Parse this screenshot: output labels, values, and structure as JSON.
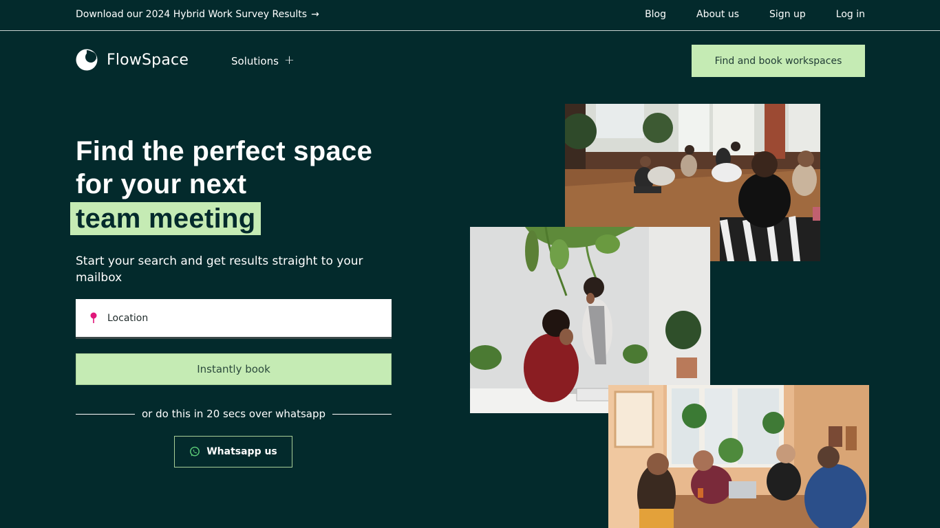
{
  "topbar": {
    "promo_text": "Download our 2024 Hybrid Work Survey Results",
    "promo_arrow": "→",
    "nav": [
      {
        "label": "Blog"
      },
      {
        "label": "About us"
      },
      {
        "label": "Sign up"
      },
      {
        "label": "Log in"
      }
    ]
  },
  "header": {
    "brand": "FlowSpace",
    "solutions_label": "Solutions",
    "solutions_icon": "+",
    "cta_label": "Find and book workspaces"
  },
  "hero": {
    "headline_line1": "Find the perfect space",
    "headline_line2": "for your next",
    "headline_highlight": "team meeting",
    "subtext": "Start your search and get results straight to your mailbox",
    "location_placeholder": "Location",
    "book_label": "Instantly book",
    "divider_text": "or do this in 20 secs over whatsapp",
    "whatsapp_label": "Whatsapp us"
  },
  "colors": {
    "background": "#032a2c",
    "accent": "#c5ebb4",
    "pin": "#e0177a"
  },
  "icons": {
    "logo": "flowspace-logo-icon",
    "pin": "location-pin-icon",
    "whatsapp": "whatsapp-icon"
  }
}
